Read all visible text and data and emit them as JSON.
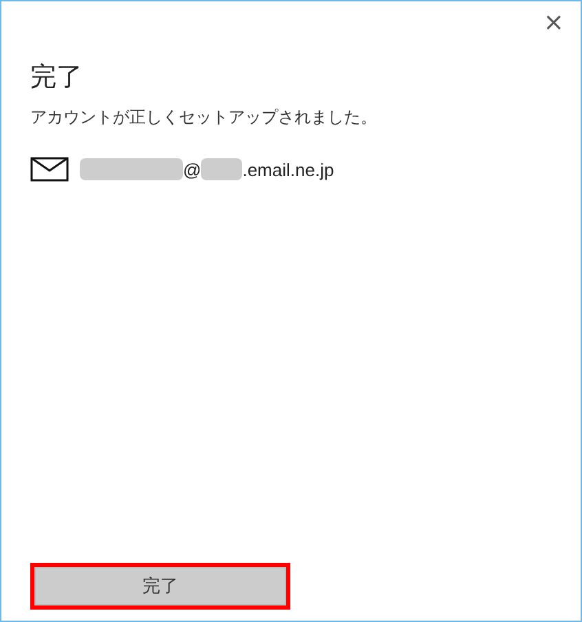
{
  "close_button": {
    "label": "×"
  },
  "title": "完了",
  "message": "アカウントが正しくセットアップされました。",
  "account": {
    "redacted_parts": [
      "@",
      ".email.ne.jp"
    ]
  },
  "buttons": [
    {
      "label": "完了",
      "highlighted": true
    }
  ]
}
